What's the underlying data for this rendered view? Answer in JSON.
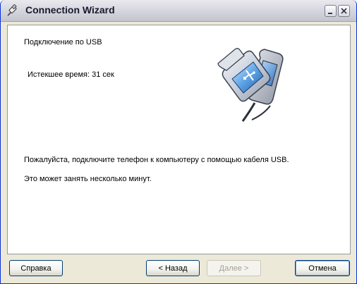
{
  "window": {
    "title": "Connection Wizard"
  },
  "content": {
    "heading": "Подключение по USB",
    "elapsed": "Истекшее время: 31 сек",
    "instruction": "Пожалуйста, подключите телефон к компьютеру с помощью кабеля USB.",
    "note": "Это может занять несколько минут."
  },
  "buttons": {
    "help": "Справка",
    "back": "< Назад",
    "next": "Далее >",
    "cancel": "Отмена"
  },
  "icons": {
    "title": "usb-cable-icon",
    "illustration": "usb-phone-connection-icon"
  },
  "colors": {
    "window_border": "#0831d9",
    "face": "#ece9d8",
    "client_border": "#919b9c"
  }
}
